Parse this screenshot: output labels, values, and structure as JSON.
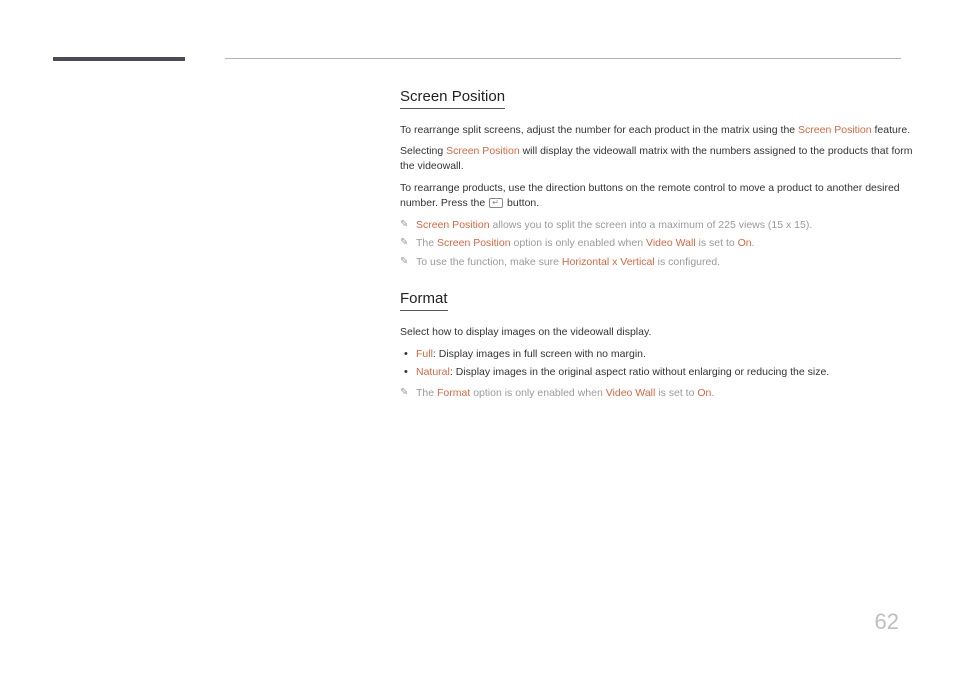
{
  "section1": {
    "heading": "Screen Position",
    "para1_a": "To rearrange split screens, adjust the number for each product in the matrix using the ",
    "para1_hl": "Screen Position",
    "para1_b": " feature.",
    "para2_a": "Selecting ",
    "para2_hl": "Screen Position",
    "para2_b": " will display the videowall matrix with the numbers assigned to the products that form the videowall.",
    "para3_a": "To rearrange products, use the direction buttons on the remote control to move a product to another desired number. Press the ",
    "para3_b": " button.",
    "note1_hl": "Screen Position",
    "note1_rest": " allows you to split the screen into a maximum of 225 views (15 x 15).",
    "note2_a": "The ",
    "note2_hl1": "Screen Position",
    "note2_mid": " option is only enabled when ",
    "note2_hl2": "Video Wall",
    "note2_mid2": " is set to ",
    "note2_hl3": "On",
    "note2_end": ".",
    "note3_a": "To use the function, make sure ",
    "note3_hl": "Horizontal x Vertical",
    "note3_b": " is configured."
  },
  "section2": {
    "heading": "Format",
    "para1": "Select how to display images on the videowall display.",
    "bullet1_hl": "Full",
    "bullet1_rest": ": Display images in full screen with no margin.",
    "bullet2_hl": "Natural",
    "bullet2_rest": ": Display images in the original aspect ratio without enlarging or reducing the size.",
    "note1_a": "The ",
    "note1_hl1": "Format",
    "note1_mid": " option is only enabled when ",
    "note1_hl2": "Video Wall",
    "note1_mid2": " is set to ",
    "note1_hl3": "On",
    "note1_end": "."
  },
  "pageNumber": "62"
}
